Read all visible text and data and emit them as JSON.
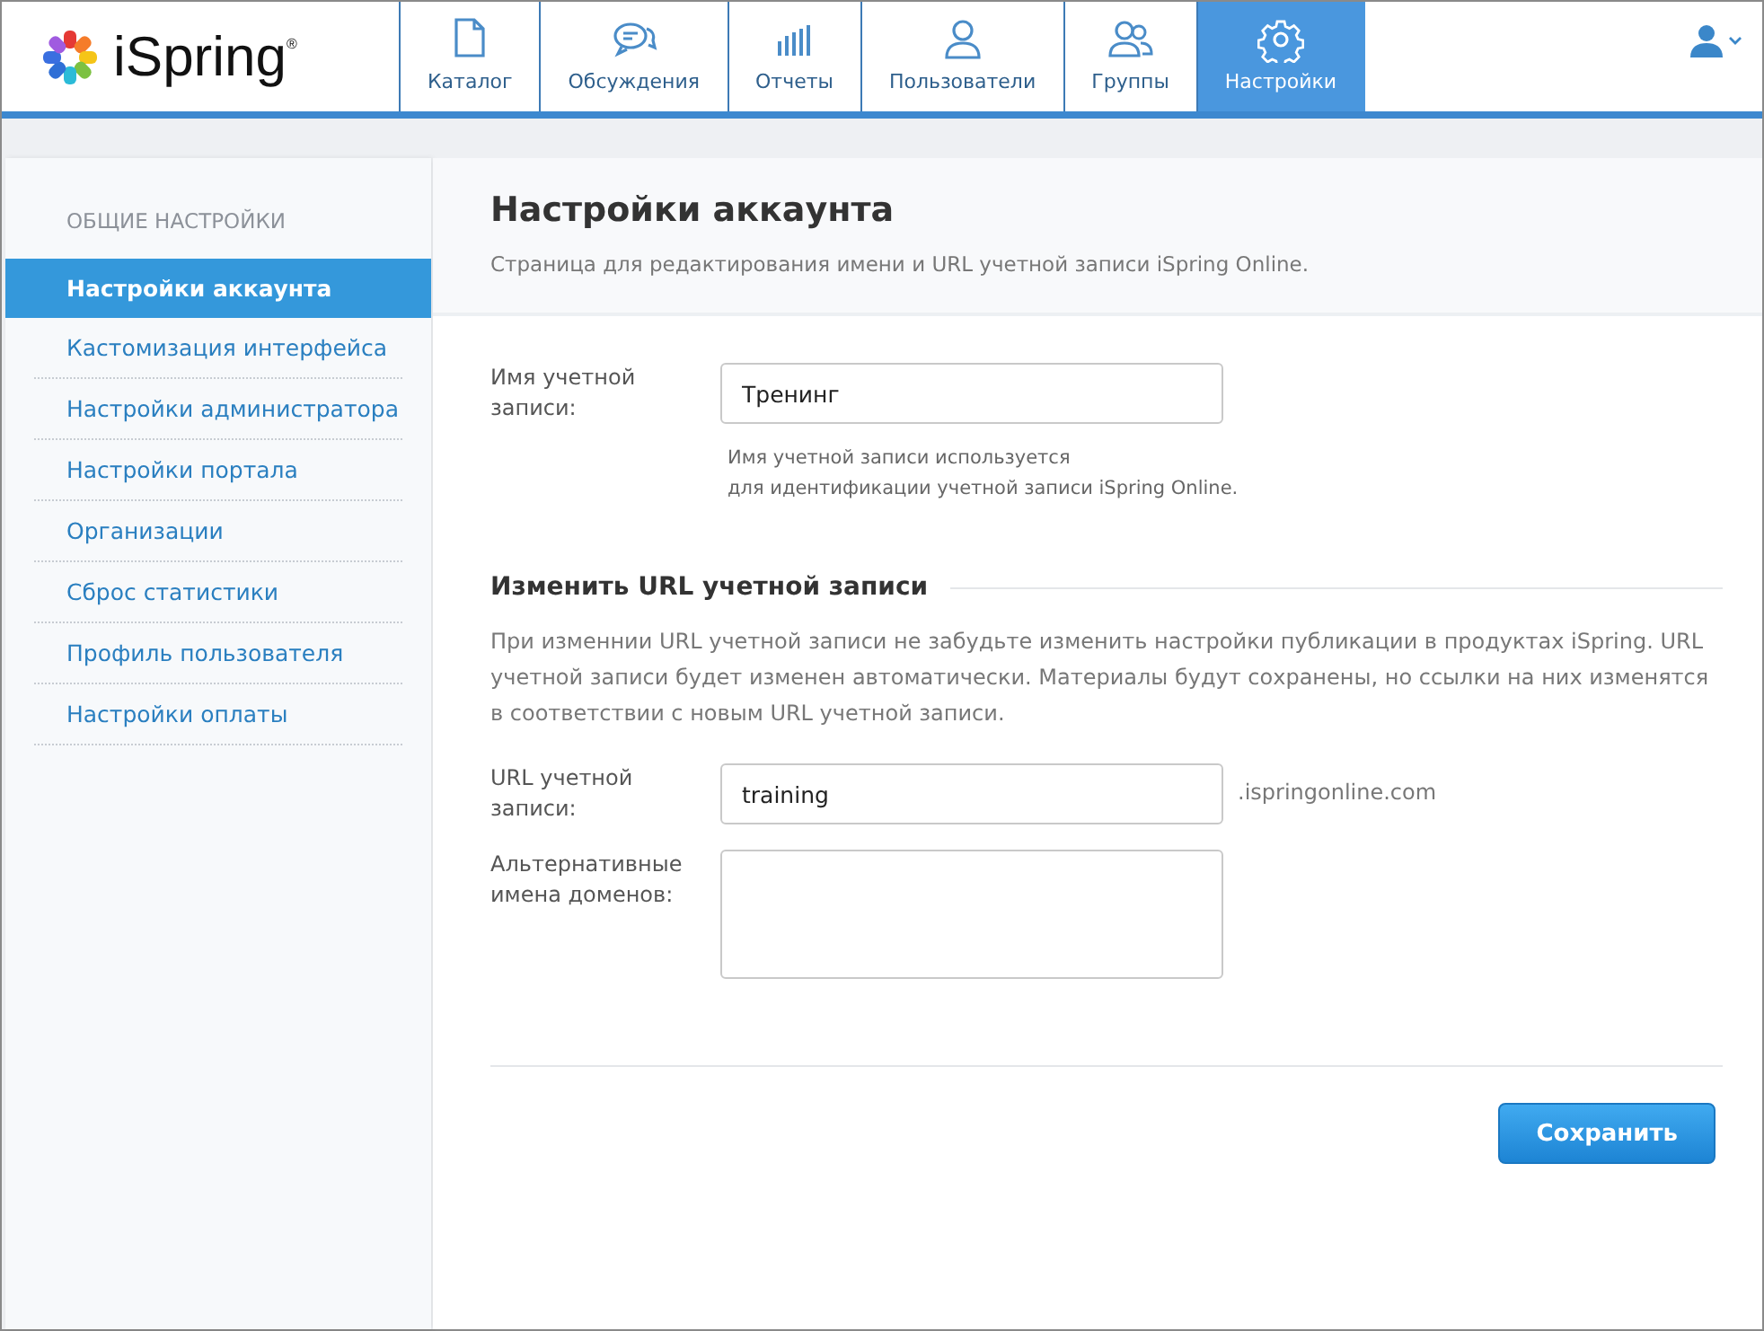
{
  "logo": {
    "text": "iSpring$^{®}$"
  },
  "nav": [
    {
      "label": "Каталог",
      "kind": "document",
      "selected": false
    },
    {
      "label": "Обсуждения",
      "kind": "chat",
      "selected": false
    },
    {
      "label": "Отчеты",
      "kind": "reports",
      "selected": false
    },
    {
      "label": "Пользователи",
      "kind": "user",
      "selected": false
    },
    {
      "label": "Группы",
      "kind": "group",
      "selected": false
    },
    {
      "label": "Настройки",
      "kind": "settings",
      "selected": true
    }
  ],
  "sidebar": {
    "heading": "ОБЩИЕ НАСТРОЙКИ",
    "items": [
      {
        "label": "Настройки аккаунта",
        "selected": true
      },
      {
        "label": "Кастомизация интерфейса",
        "selected": false
      },
      {
        "label": "Настройки администратора",
        "selected": false
      },
      {
        "label": "Настройки портала",
        "selected": false
      },
      {
        "label": "Организации",
        "selected": false
      },
      {
        "label": "Сброс статистики",
        "selected": false
      },
      {
        "label": "Профиль пользователя",
        "selected": false
      },
      {
        "label": "Настройки оплаты",
        "selected": false
      }
    ]
  },
  "page": {
    "title": "Настройки аккаунта",
    "subtitle": "Страница для редактирования имени и URL учетной записи iSpring Online."
  },
  "account_name": {
    "label": "Имя учетной записи:",
    "value": "Тренинг",
    "hint": [
      "Имя учетной записи используется",
      "для идентификации учетной записи iSpring Online."
    ]
  },
  "url_section": {
    "heading": "Изменить URL учетной записи",
    "description": "При изменнии URL учетной записи не забудьте изменить настройки публикации в продуктах iSpring. URL учетной записи будет изменен автоматически. Материалы будут сохранены, но ссылки на них изменятся в соответствии с новым URL учетной записи.",
    "fields": [
      {
        "kind": "text",
        "label": "URL учетной записи:",
        "value": "training",
        "suffix": ".ispringonline.com"
      },
      {
        "kind": "textarea",
        "label": "Альтернативные имена доменов:"
      }
    ]
  },
  "save_button": "Сохранить"
}
